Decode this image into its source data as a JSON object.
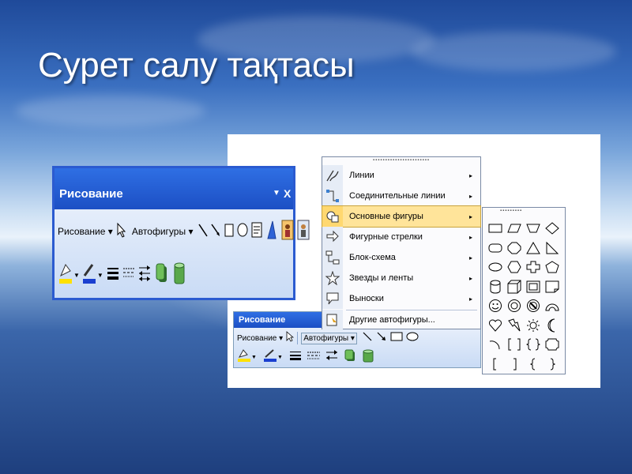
{
  "slide": {
    "title": "Сурет салу тақтасы"
  },
  "colors": {
    "title_bar": "#1c4fc4",
    "menu_highlight": "#ffe49a",
    "fill_yellow": "#ffe100",
    "line_blue": "#1a3fd0"
  },
  "toolbar_large": {
    "title": "Рисование",
    "title_controls": {
      "dropdown": "▼",
      "close": "X"
    },
    "draw_menu_label": "Рисование",
    "autoshapes_label": "Автофигуры",
    "dropdown_arrow": "▾"
  },
  "toolbar_small": {
    "title": "Рисование",
    "draw_menu_label": "Рисование",
    "autoshapes_label": "Автофигуры",
    "dropdown_arrow": "▾"
  },
  "autoshapes_menu": {
    "grip": "▪▪▪▪▪▪▪▪▪▪▪▪▪▪▪▪▪▪▪▪▪▪▪",
    "items": [
      {
        "label": "Линии",
        "icon": "lines-icon",
        "has_submenu": true
      },
      {
        "label": "Соединительные линии",
        "icon": "connectors-icon",
        "has_submenu": true
      },
      {
        "label": "Основные фигуры",
        "icon": "basic-shapes-icon",
        "has_submenu": true,
        "selected": true
      },
      {
        "label": "Фигурные стрелки",
        "icon": "block-arrows-icon",
        "has_submenu": true
      },
      {
        "label": "Блок-схема",
        "icon": "flowchart-icon",
        "has_submenu": true
      },
      {
        "label": "Звезды и ленты",
        "icon": "stars-icon",
        "has_submenu": true
      },
      {
        "label": "Выноски",
        "icon": "callouts-icon",
        "has_submenu": true
      },
      {
        "label": "Другие автофигуры...",
        "icon": "more-autoshapes-icon",
        "has_submenu": false
      }
    ],
    "submenu_arrow": "▸"
  },
  "basic_shapes_palette": {
    "grip": "▪▪▪▪▪▪▪▪▪",
    "shapes": [
      "rectangle-icon",
      "parallelogram-icon",
      "trapezoid-icon",
      "diamond-icon",
      "rounded-rectangle-icon",
      "octagon-icon",
      "triangle-icon",
      "right-triangle-icon",
      "oval-icon",
      "hexagon-icon",
      "cross-icon",
      "pentagon-icon",
      "can-icon",
      "cube-icon",
      "bevel-icon",
      "folded-corner-icon",
      "smiley-icon",
      "donut-icon",
      "no-symbol-icon",
      "block-arc-icon",
      "heart-icon",
      "lightning-icon",
      "sun-icon",
      "moon-icon",
      "arc-icon",
      "double-bracket-icon",
      "double-brace-icon",
      "plaque-icon",
      "left-bracket-icon",
      "right-bracket-icon",
      "left-brace-icon",
      "right-brace-icon"
    ]
  }
}
